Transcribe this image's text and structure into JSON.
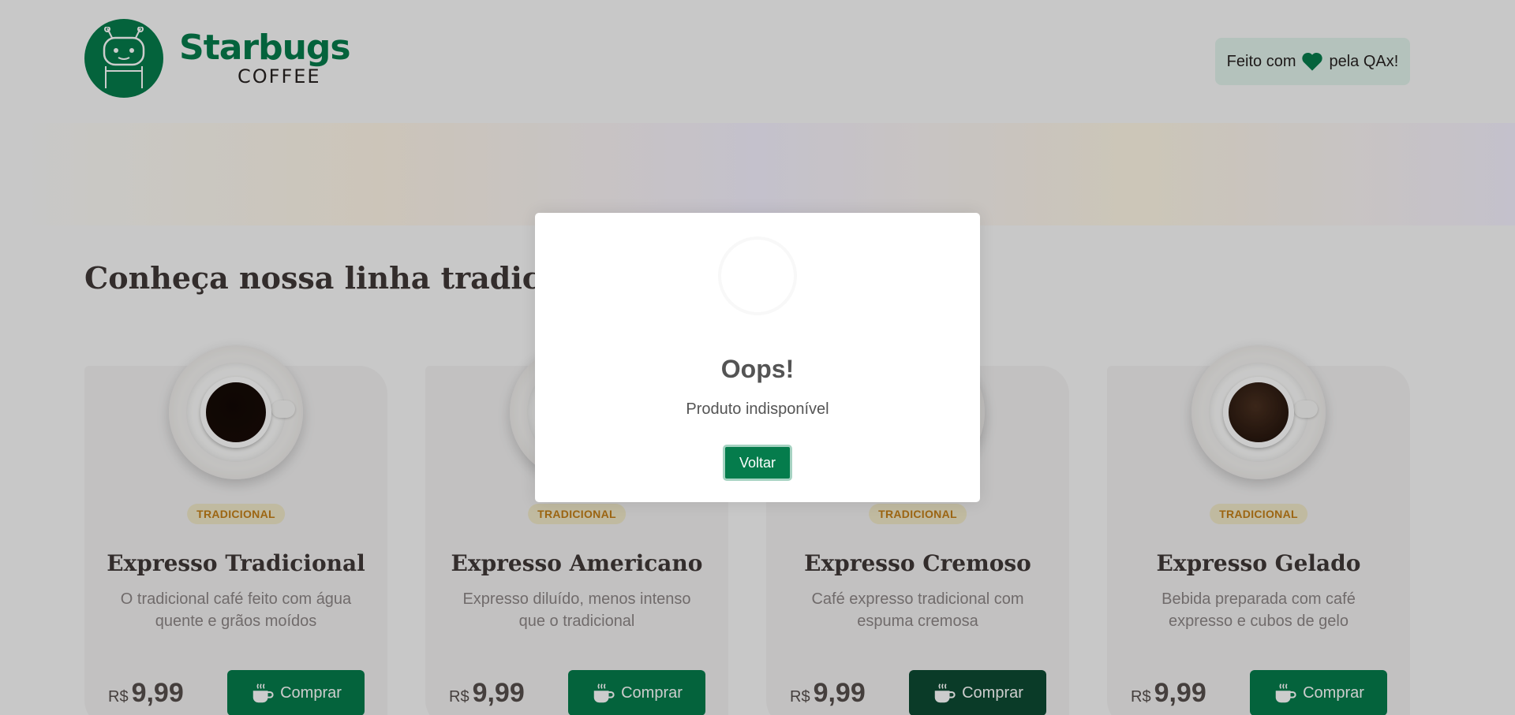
{
  "header": {
    "logo_name": "Starbugs",
    "logo_sub": "COFFEE",
    "made_with_prefix": "Feito com",
    "made_with_suffix": "pela QAx!"
  },
  "colors": {
    "brand_green": "#057c4c",
    "dark_green_button": "#0d4a32",
    "tag_text": "#c47f17",
    "tag_bg": "#f1e9c9"
  },
  "main": {
    "section_title": "Conheça nossa linha tradicional"
  },
  "products": [
    {
      "tag": "TRADICIONAL",
      "name": "Expresso Tradicional",
      "desc": "O tradicional café feito com água quente e grãos moídos",
      "currency": "R$",
      "price": "9,99",
      "buy_label": "Comprar",
      "coffee_color": "#120806"
    },
    {
      "tag": "TRADICIONAL",
      "name": "Expresso Americano",
      "desc": "Expresso diluído, menos intenso que o tradicional",
      "currency": "R$",
      "price": "9,99",
      "buy_label": "Comprar",
      "coffee_color": "#3a2418"
    },
    {
      "tag": "TRADICIONAL",
      "name": "Expresso Cremoso",
      "desc": "Café expresso tradicional com espuma cremosa",
      "currency": "R$",
      "price": "9,99",
      "buy_label": "Comprar",
      "coffee_color": "#7a4a2c"
    },
    {
      "tag": "TRADICIONAL",
      "name": "Expresso Gelado",
      "desc": "Bebida preparada com café expresso e cubos de gelo",
      "currency": "R$",
      "price": "9,99",
      "buy_label": "Comprar",
      "coffee_color": "#4a3020"
    }
  ],
  "modal": {
    "title": "Oops!",
    "text": "Produto indisponível",
    "button_label": "Voltar"
  }
}
